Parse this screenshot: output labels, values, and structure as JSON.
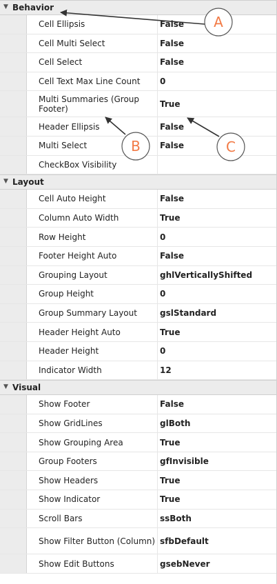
{
  "categories": [
    {
      "label": "Behavior",
      "rows": [
        {
          "name": "Cell Ellipsis",
          "value": "False"
        },
        {
          "name": "Cell Multi Select",
          "value": "False"
        },
        {
          "name": "Cell Select",
          "value": "False"
        },
        {
          "name": "Cell Text Max Line Count",
          "value": "0"
        },
        {
          "name": "Multi Summaries (Group Footer)",
          "value": "True"
        },
        {
          "name": "Header Ellipsis",
          "value": "False"
        },
        {
          "name": "Multi Select",
          "value": "False"
        },
        {
          "name": "CheckBox Visibility",
          "value": ""
        }
      ]
    },
    {
      "label": "Layout",
      "rows": [
        {
          "name": "Cell Auto Height",
          "value": "False"
        },
        {
          "name": "Column Auto Width",
          "value": "True"
        },
        {
          "name": "Row Height",
          "value": "0"
        },
        {
          "name": "Footer Height Auto",
          "value": "False"
        },
        {
          "name": "Grouping Layout",
          "value": "ghlVerticallyShifted"
        },
        {
          "name": "Group Height",
          "value": "0"
        },
        {
          "name": "Group Summary Layout",
          "value": "gslStandard"
        },
        {
          "name": "Header Height Auto",
          "value": "True"
        },
        {
          "name": "Header Height",
          "value": "0"
        },
        {
          "name": "Indicator Width",
          "value": "12"
        }
      ]
    },
    {
      "label": "Visual",
      "rows": [
        {
          "name": "Show Footer",
          "value": "False"
        },
        {
          "name": "Show GridLines",
          "value": "glBoth"
        },
        {
          "name": "Show Grouping Area",
          "value": "True"
        },
        {
          "name": "Group Footers",
          "value": "gfInvisible"
        },
        {
          "name": "Show Headers",
          "value": "True"
        },
        {
          "name": "Show Indicator",
          "value": "True"
        },
        {
          "name": "Scroll Bars",
          "value": "ssBoth"
        },
        {
          "name": "Show Filter Button (Column)",
          "value": "sfbDefault"
        },
        {
          "name": "Show Edit Buttons",
          "value": "gsebNever"
        }
      ]
    }
  ],
  "callouts": {
    "a": "A",
    "b": "B",
    "c": "C"
  },
  "accent_color": "#f27a45"
}
